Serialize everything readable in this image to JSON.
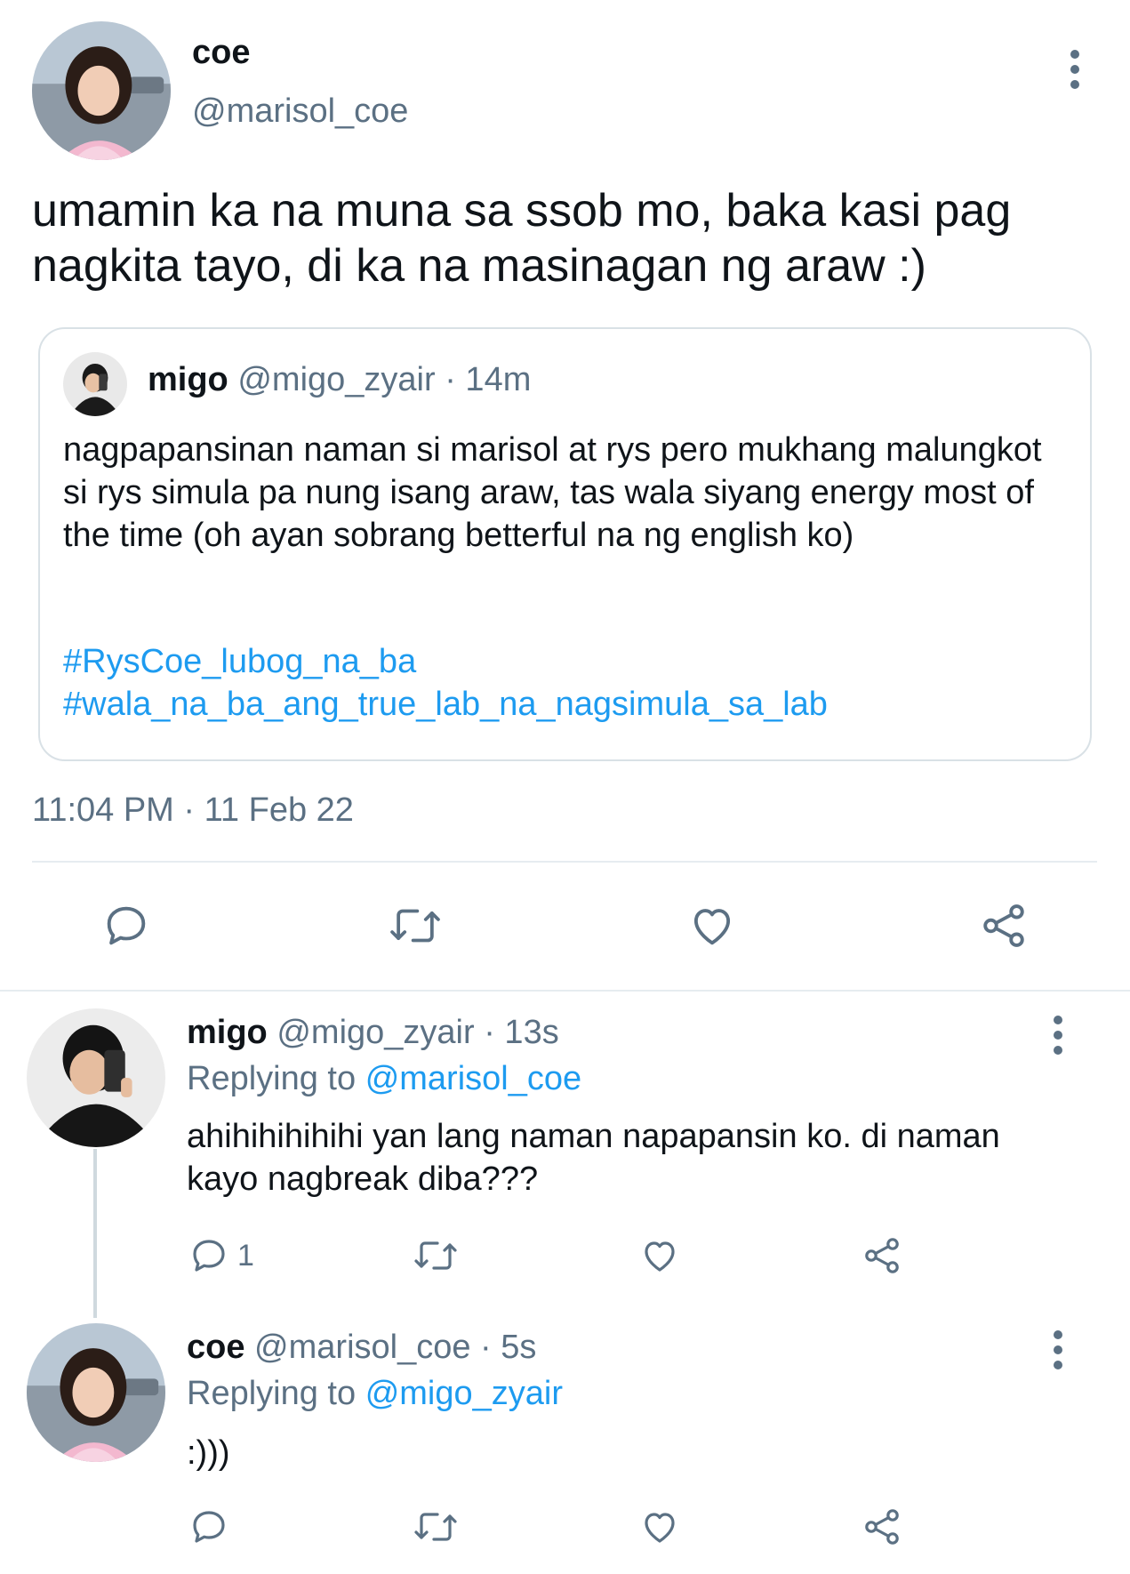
{
  "main_tweet": {
    "author_name": "coe",
    "author_handle": "@marisol_coe",
    "text": "umamin ka na muna sa ssob mo, baka kasi pag nagkita tayo, di ka na masinagan ng araw :)",
    "timestamp": "11:04 PM · 11 Feb 22",
    "quoted": {
      "author_name": "migo",
      "author_handle": "@migo_zyair",
      "age": "· 14m",
      "text": "nagpapansinan naman si marisol at rys pero mukhang malungkot si rys simula pa nung isang araw, tas wala siyang energy most of the time (oh ayan sobrang betterful na ng english ko)",
      "hashtag_1": "#RysCoe_lubog_na_ba",
      "hashtag_2": "#wala_na_ba_ang_true_lab_na_nagsimula_sa_lab"
    },
    "actions": [
      "reply-icon",
      "retweet-icon",
      "like-icon",
      "share-icon"
    ]
  },
  "replies": [
    {
      "author_name": "migo",
      "author_handle": "@migo_zyair",
      "age": "· 13s",
      "replying_label": "Replying to",
      "replying_to": "@marisol_coe",
      "text": "ahihihihihihi yan lang naman napapansin ko. di naman kayo nagbreak diba???",
      "reply_count": "1"
    },
    {
      "author_name": "coe",
      "author_handle": "@marisol_coe",
      "age": "· 5s",
      "replying_label": "Replying to",
      "replying_to": "@migo_zyair",
      "text": ":)))"
    }
  ],
  "colors": {
    "link": "#1d9bf0",
    "muted": "#5b7083",
    "border": "#d9e1e6",
    "text": "#0f1419"
  }
}
